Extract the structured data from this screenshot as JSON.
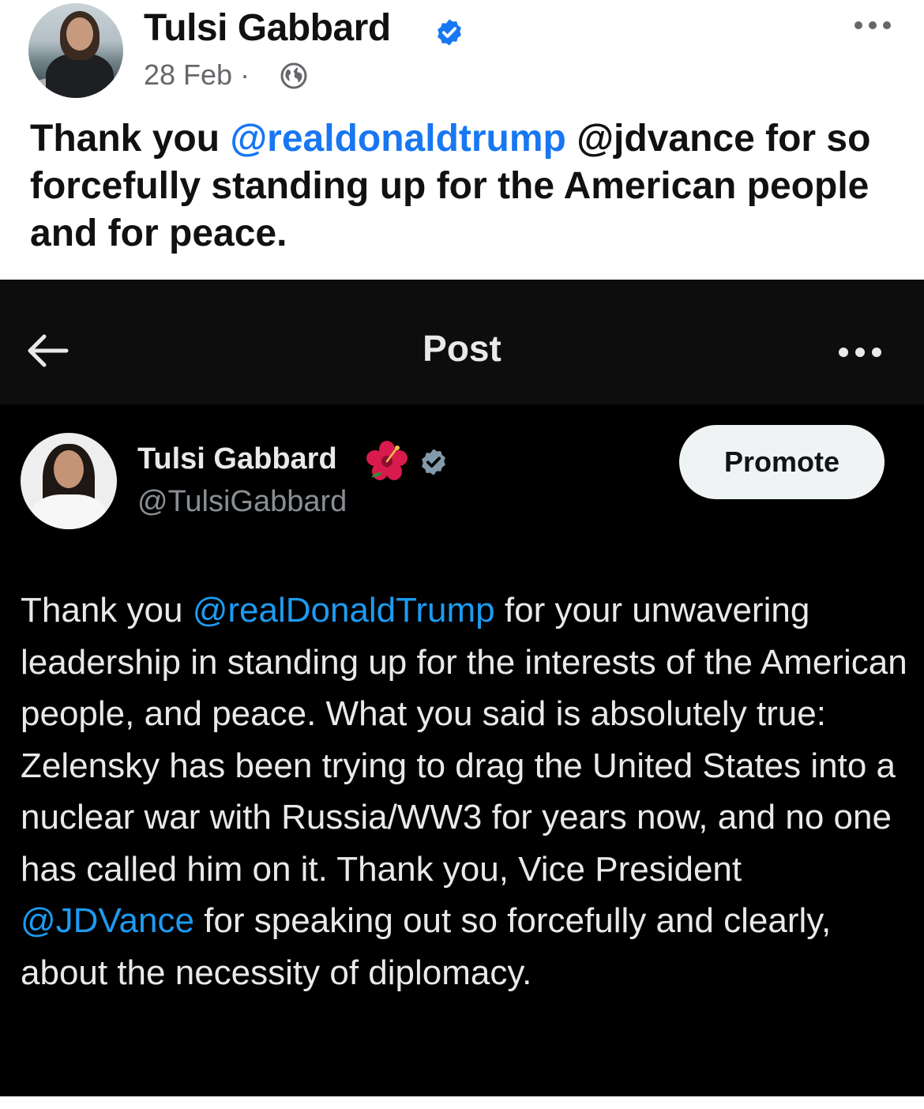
{
  "fb_post": {
    "author_name": "Tulsi Gabbard",
    "date": "28 Feb",
    "separator": "·",
    "icons": {
      "verified": "verified-badge-icon",
      "audience": "globe-icon",
      "menu": "more-dots-icon"
    },
    "text_parts": [
      {
        "text": "Thank you ",
        "mention": false
      },
      {
        "text": "@realdonaldtrump",
        "mention": true
      },
      {
        "text": " @jdvance for so forcefully standing up for the American people and for peace.",
        "mention": false
      }
    ],
    "colors": {
      "mention": "#1877f2",
      "verified": "#1877f2"
    }
  },
  "x_screenshot": {
    "nav": {
      "title": "Post",
      "back_icon": "arrow-left-icon",
      "more_icon": "more-dots-icon"
    },
    "author": {
      "name": "Tulsi Gabbard",
      "emoji": "🌺",
      "handle": "@TulsiGabbard",
      "verified_icon": "verified-badge-icon"
    },
    "promote_label": "Promote",
    "text_parts": [
      {
        "text": "Thank you ",
        "mention": false
      },
      {
        "text": "@realDonaldTrump",
        "mention": true
      },
      {
        "text": " for your unwavering leadership in standing up for the interests of the American people, and peace. What you said is absolutely true: Zelensky has been trying to drag the United States into a nuclear war with Russia/WW3 for years now, and no one has called him on it. Thank you, Vice President ",
        "mention": false
      },
      {
        "text": "@JDVance",
        "mention": true
      },
      {
        "text": " for speaking out so forcefully and clearly, about the necessity of diplomacy.",
        "mention": false
      }
    ],
    "colors": {
      "background": "#000000",
      "mention": "#1d9bf0",
      "text": "#e7e9ea"
    }
  }
}
